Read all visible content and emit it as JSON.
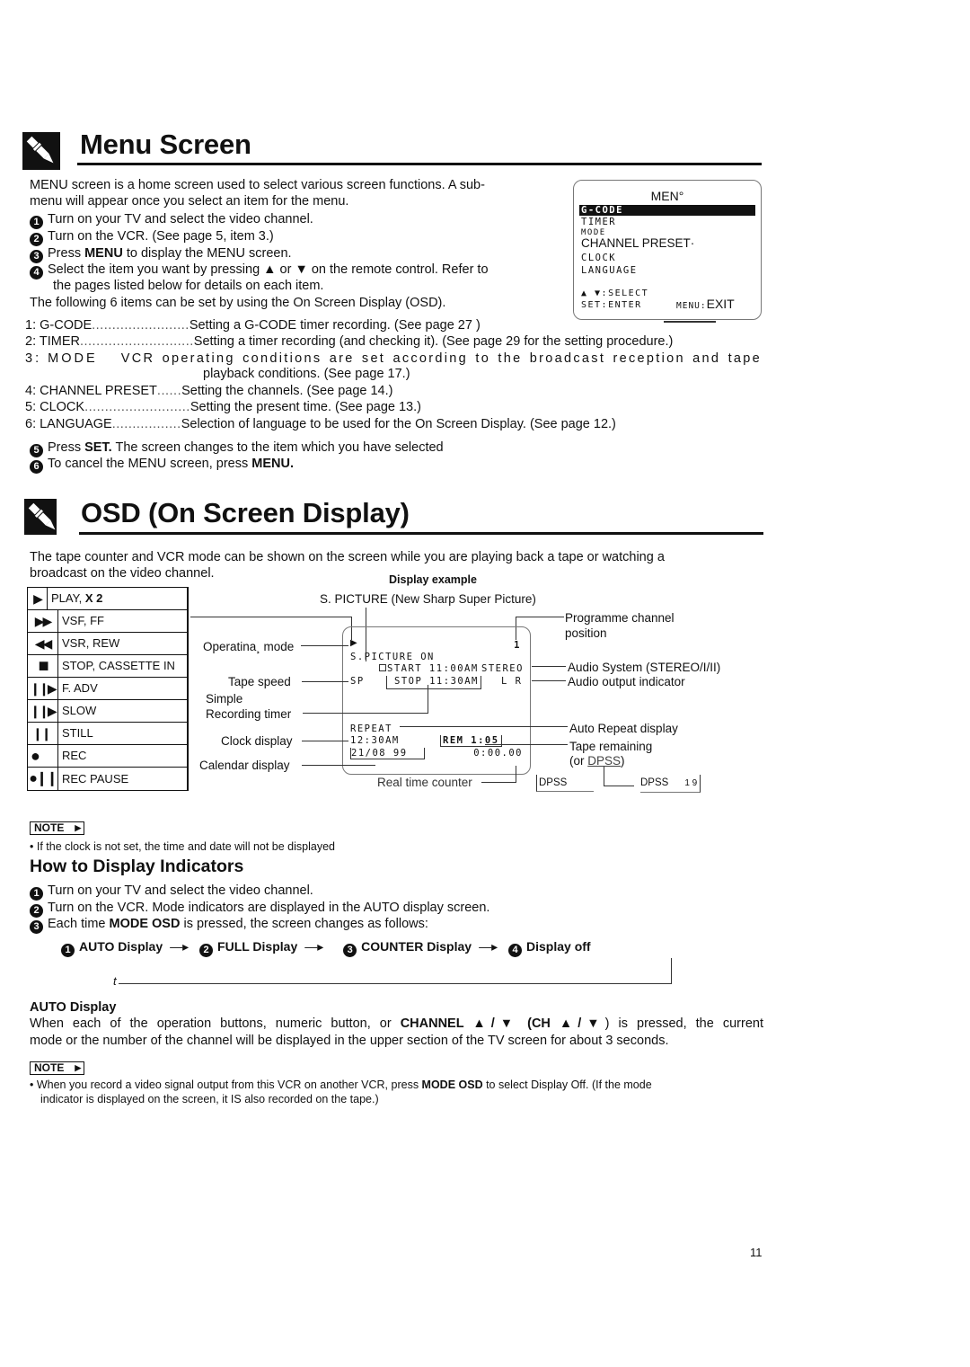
{
  "menu_section": {
    "title": "Menu Screen",
    "intro_line1": "MENU screen is a home screen used to select various screen functions. A sub-",
    "intro_line2": "menu will appear once you select an item for the menu.",
    "steps": [
      {
        "num": "1",
        "pre": "Turn on your TV and select the video channel.",
        "bold": "",
        "post": ""
      },
      {
        "num": "2",
        "pre": "Turn on the VCR. (See page 5, item 3.)",
        "bold": "",
        "post": ""
      },
      {
        "num": "3",
        "pre": "Press ",
        "bold": "MENU",
        "post": " to display the MENU screen."
      },
      {
        "num": "4",
        "pre": "Select the item you want by pressing ▲ or ▼ on the remote control. Refer to",
        "bold": "",
        "post": ""
      }
    ],
    "step4_cont": "the pages listed below for details on each item.",
    "following": "The following 6 items can be set by using the On Screen Display (OSD).",
    "screen": {
      "title": "MEN°",
      "items": [
        "G-CODE",
        "TIMER",
        "MODE",
        "CHANNEL PRESET·",
        "CLOCK",
        "LANGUAGE"
      ],
      "selected": "G-CODE",
      "hint_select": "▲ ▼:SELECT",
      "hint_enter": "SET:ENTER",
      "hint_menu": "MENU:",
      "hint_exit": "EXIT"
    },
    "items": [
      {
        "label": "1: G-CODE",
        "dots": "........................",
        "desc": "Setting a G-CODE timer recording. (See page 27 )"
      },
      {
        "label": "2: TIMER",
        "dots": "............................",
        "desc": "Setting a timer recording (and checking it). (See page 29 for the setting procedure.)"
      },
      {
        "label": "3: MODE",
        "dots": "",
        "desc": "VCR operating conditions are set according to the broadcast reception and tape"
      },
      {
        "label": "4: CHANNEL PRESET",
        "dots": "......",
        "desc": "Setting the channels. (See page 14.)"
      },
      {
        "label": "5: CLOCK",
        "dots": "..........................",
        "desc": "Setting the present time. (See page 13.)"
      },
      {
        "label": "6: LANGUAGE",
        "dots": ".................",
        "desc": "Selection of language to be used for the On Screen Display. (See page 12.)"
      }
    ],
    "item3_cont": "playback conditions. (See page 17.)",
    "step5": {
      "num": "5",
      "pre": "Press ",
      "bold": "SET.",
      "post": " The screen changes to the item which you have selected"
    },
    "step6": {
      "num": "6",
      "pre": "To cancel the MENU screen, press ",
      "bold": "MENU.",
      "post": ""
    }
  },
  "osd_section": {
    "title": "OSD (On Screen Display)",
    "intro_line1": "The tape counter and VCR mode can be shown on the screen while you are playing back a tape or watching a",
    "intro_line2": "broadcast on the video channel.",
    "display_example_label": "Display example",
    "modes": [
      {
        "symbol": "▶",
        "label": "PLAY, ",
        "bold": "X 2"
      },
      {
        "symbol": "▶▶",
        "label": "VSF, FF",
        "bold": ""
      },
      {
        "symbol": "◀◀",
        "label": "VSR, REW",
        "bold": ""
      },
      {
        "symbol": "■",
        "label": "STOP, CASSETTE IN",
        "bold": ""
      },
      {
        "symbol": "❙❙▶",
        "label": "F. ADV",
        "bold": ""
      },
      {
        "symbol": "❙❙▶",
        "label": "SLOW",
        "bold": ""
      },
      {
        "symbol": "❙❙",
        "label": "STILL",
        "bold": ""
      },
      {
        "symbol": "●",
        "label": "REC",
        "bold": ""
      },
      {
        "symbol": "●❙❙",
        "label": "REC PAUSE",
        "bold": ""
      }
    ],
    "screen": {
      "op_mode_symbol": "▶",
      "channel": "1",
      "spicture": "S.PICTURE ON",
      "start": "START 11:00AM",
      "stereo": "STEREO",
      "speed": "SP",
      "stop": "STOP  11:30AM",
      "lr": "L R",
      "repeat": "REPEAT",
      "clock": "12:30AM",
      "rem": "REM 1:05",
      "date": "21/08 99",
      "counter": "0:00.00"
    },
    "callouts": {
      "spicture": "S. PICTURE (New Sharp Super Picture)",
      "programme1": "Programme  channel",
      "programme2": "position",
      "operating_mode": "Operatina¸ mode",
      "tape_speed": "Tape  speed",
      "simple": "Simple",
      "recording_timer": "Recording  timer",
      "clock_display": "Clock  display",
      "calendar_display": "Calendar  display",
      "audio_system": "Audio System (STEREO/I/II)",
      "audio_output": "Audio  output  indicator",
      "auto_repeat": "Auto  Repeat  display",
      "tape_remaining": "Tape  remaining",
      "or_dpss_pre": "(or ",
      "or_dpss": "DPSS",
      "or_dpss_post": ")",
      "real_time_counter": "Real time counter",
      "dpss_a": "DPSS",
      "dpss_b": "DPSS",
      "dpss_b_num": "1 9"
    },
    "note1_badge": "NOTE",
    "note1_text": "If the clock is not set, the time and date will not be displayed"
  },
  "indicators_section": {
    "title": "How to Display Indicators",
    "steps": [
      {
        "num": "1",
        "pre": "Turn on your TV and select the video channel.",
        "bold": "",
        "post": ""
      },
      {
        "num": "2",
        "pre": "Turn on the VCR. Mode indicators are displayed in the AUTO display screen.",
        "bold": "",
        "post": ""
      },
      {
        "num": "3",
        "pre": "Each time ",
        "bold": "MODE OSD",
        "post": " is pressed, the screen changes as follows:"
      }
    ],
    "flow": [
      {
        "num": "1",
        "label": "AUTO  Display"
      },
      {
        "num": "2",
        "label": "FULL  Display"
      },
      {
        "num": "3",
        "label": "COUNTER  Display"
      },
      {
        "num": "4",
        "label": "Display  off"
      }
    ],
    "flow_return_mark": "t",
    "auto_heading": "AUTO Display",
    "auto_line1_pre": "When each of the operation buttons, numeric button, or ",
    "auto_line1_bold": "CHANNEL ▲/▼ (CH ▲/▼",
    "auto_line1_post": ") is pressed, the current",
    "auto_line2": "mode or the number of the channel will be displayed in the upper section of the TV screen for about 3 seconds.",
    "note2_badge": "NOTE",
    "note2_pre": "When you record a video signal output from this VCR on another VCR, press ",
    "note2_bold": "MODE OSD",
    "note2_post": " to select Display Off. (If the mode",
    "note2_line2": "indicator is displayed on the screen, it IS also recorded on the tape.)"
  },
  "page_number": "11"
}
